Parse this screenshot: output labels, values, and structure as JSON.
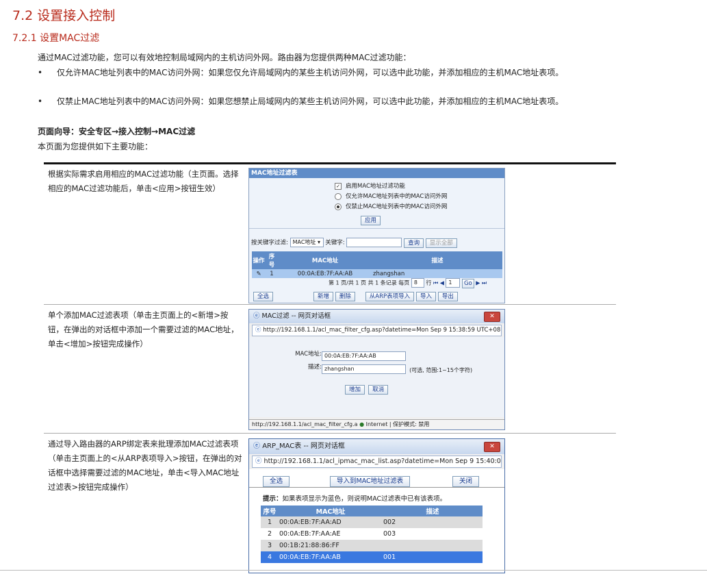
{
  "heading": "7.2 设置接入控制",
  "subheading": "7.2.1 设置MAC过滤",
  "intro": "通过MAC过滤功能，您可以有效地控制局域网内的主机访问外网。路由器为您提供两种MAC过滤功能：",
  "bullets": [
    "仅允许MAC地址列表中的MAC访问外网：如果您仅允许局域网内的某些主机访问外网，可以选中此功能，并添加相应的主机MAC地址表项。",
    "仅禁止MAC地址列表中的MAC访问外网：如果您想禁止局域网内的某些主机访问外网，可以选中此功能，并添加相应的主机MAC地址表项。"
  ],
  "nav_guide": "页面向导：安全专区→接入控制→MAC过滤",
  "page_provides": "本页面为您提供如下主要功能：",
  "rows": [
    "根据实际需求启用相应的MAC过滤功能（主页面。选择相应的MAC过滤功能后，单击<应用>按钮生效）",
    "单个添加MAC过滤表项（单击主页面上的<新增>按钮，在弹出的对话框中添加一个需要过滤的MAC地址，单击<增加>按钮完成操作）",
    "通过导入路由器的ARP绑定表来批理添加MAC过滤表项（单击主页面上的<从ARP表项导入>按钮，在弹出的对话框中选择需要过滤的MAC地址，单击<导入MAC地址过滤表>按钮完成操作）"
  ],
  "shot1": {
    "title": "MAC地址过滤表",
    "enable": "启用MAC地址过滤功能",
    "opt_allow": "仅允许MAC地址列表中的MAC访问外网",
    "opt_deny": "仅禁止MAC地址列表中的MAC访问外网",
    "apply": "应用",
    "filter_label": "按关键字过滤:",
    "filter_select": "MAC地址",
    "keyword_label": "关键字:",
    "query": "查询",
    "show_all": "显示全部",
    "cols": [
      "操作",
      "序号",
      "MAC地址",
      "描述"
    ],
    "row": {
      "no": "1",
      "mac": "00:0A:EB:7F:AA:AB",
      "desc": "zhangshan"
    },
    "pager_a": "第 1 页/共 1 页 共 1 条记录 每页",
    "per_page": "8",
    "pager_b": "行",
    "page_no": "1",
    "go": "Go",
    "select_all": "全选",
    "add": "新增",
    "delete": "删除",
    "import_arp": "从ARP表项导入",
    "import": "导入",
    "export": "导出"
  },
  "shot2": {
    "title": "MAC过滤 -- 网页对话框",
    "url": "http://192.168.1.1/acl_mac_filter_cfg.asp?datetime=Mon Sep 9 15:38:59 UTC+0800 2013",
    "mac_label": "MAC地址:",
    "mac_value": "00:0A:EB:7F:AA:AB",
    "desc_label": "描述:",
    "desc_value": "zhangshan",
    "hint": "(可选, 范围:1~15个字符)",
    "add": "增加",
    "cancel": "取消",
    "status": "http://192.168.1.1/acl_mac_filter_cfg.a",
    "zone": "Internet | 保护模式: 禁用"
  },
  "shot3": {
    "title": "ARP_MAC表 -- 网页对话框",
    "url": "http://192.168.1.1/acl_ipmac_mac_list.asp?datetime=Mon Sep 9 15:40:09",
    "select_all": "全选",
    "import_btn": "导入到MAC地址过滤表",
    "close": "关闭",
    "tip_label": "提示：",
    "tip": "如果表项显示为蓝色，则说明MAC过滤表中已有该表项。",
    "cols": [
      "序号",
      "MAC地址",
      "描述"
    ],
    "rows": [
      {
        "no": "1",
        "mac": "00:0A:EB:7F:AA:AD",
        "desc": "002"
      },
      {
        "no": "2",
        "mac": "00:0A:EB:7F:AA:AE",
        "desc": "003"
      },
      {
        "no": "3",
        "mac": "00:1B:21:88:86:FF",
        "desc": ""
      },
      {
        "no": "4",
        "mac": "00:0A:EB:7F:AA:AB",
        "desc": "001"
      }
    ]
  }
}
